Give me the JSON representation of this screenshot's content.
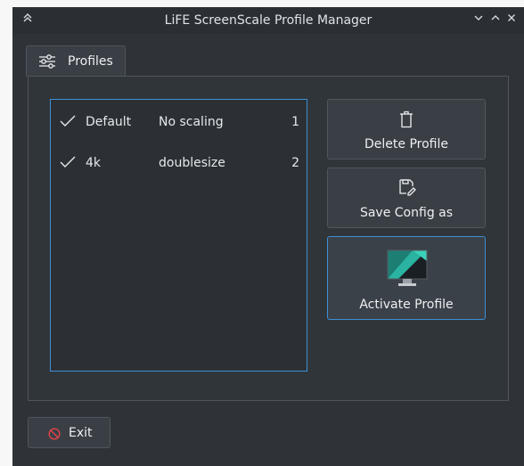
{
  "window": {
    "title": "LiFE ScreenScale Profile Manager",
    "menu_icon": "double-chevron-up-icon",
    "controls": [
      "minimize-icon",
      "maximize-icon",
      "close-icon"
    ]
  },
  "tabs": [
    {
      "label": "Profiles",
      "icon": "sliders-icon",
      "active": true
    }
  ],
  "profiles": [
    {
      "checked": true,
      "name": "Default",
      "description": "No scaling",
      "number": "1"
    },
    {
      "checked": true,
      "name": "4k",
      "description": "doublesize",
      "number": "2"
    }
  ],
  "actions": {
    "delete": {
      "label": "Delete Profile",
      "icon": "trash-icon"
    },
    "save": {
      "label": "Save Config as",
      "icon": "save-as-icon"
    },
    "activate": {
      "label": "Activate Profile",
      "icon": "monitor-icon"
    }
  },
  "footer": {
    "exit": {
      "label": "Exit",
      "icon": "cancel-icon"
    }
  },
  "colors": {
    "window_bg": "#2f3338",
    "accent": "#3d8fd6",
    "text": "#eef0f2",
    "exit_icon": "#e0444a"
  }
}
